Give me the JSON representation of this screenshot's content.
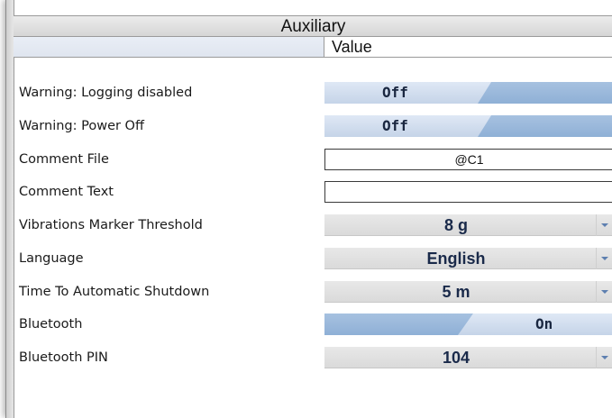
{
  "panel": {
    "title": "Auxiliary",
    "value_header": "Value"
  },
  "rows": [
    {
      "label": "Warning: Logging disabled",
      "type": "toggle",
      "value": "Off"
    },
    {
      "label": "Warning: Power Off",
      "type": "toggle",
      "value": "Off"
    },
    {
      "label": "Comment File",
      "type": "text",
      "value": "@C1"
    },
    {
      "label": "Comment Text",
      "type": "text",
      "value": ""
    },
    {
      "label": "Vibrations Marker Threshold",
      "type": "dropdown",
      "value": "8 g"
    },
    {
      "label": "Language",
      "type": "dropdown",
      "value": "English"
    },
    {
      "label": "Time To Automatic Shutdown",
      "type": "dropdown",
      "value": "5 m"
    },
    {
      "label": "Bluetooth",
      "type": "toggle",
      "value": "On"
    },
    {
      "label": "Bluetooth PIN",
      "type": "dropdown",
      "value": "104"
    }
  ],
  "colors": {
    "toggle_light": "#c5d4e8",
    "toggle_dark": "#8fb0d6",
    "dropdown_arrow": "#5d7fb0"
  }
}
